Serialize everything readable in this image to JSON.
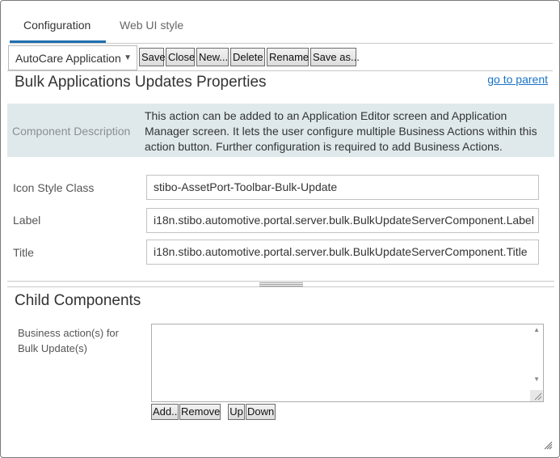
{
  "tabs": [
    {
      "label": "Configuration",
      "active": true
    },
    {
      "label": "Web UI style",
      "active": false
    }
  ],
  "toolbar": {
    "selector_value": "AutoCare Application",
    "save": "Save",
    "close": "Close",
    "new": "New...",
    "delete": "Delete",
    "rename": "Rename",
    "save_as": "Save as..."
  },
  "properties": {
    "title": "Bulk Applications Updates Properties",
    "go_to_parent": "go to parent",
    "description_label": "Component Description",
    "description_text": "This action can be added to an Application Editor screen and Application Manager screen. It lets the user configure multiple Business Actions within this action button. Further configuration is required to add Business Actions.",
    "fields": [
      {
        "label": "Icon Style Class",
        "value": "stibo-AssetPort-Toolbar-Bulk-Update"
      },
      {
        "label": "Label",
        "value": "i18n.stibo.automotive.portal.server.bulk.BulkUpdateServerComponent.Label"
      },
      {
        "label": "Title",
        "value": "i18n.stibo.automotive.portal.server.bulk.BulkUpdateServerComponent.Title"
      }
    ]
  },
  "child_components": {
    "title": "Child Components",
    "business_actions_label": "Business action(s) for Bulk Update(s)",
    "add": "Add..",
    "remove": "Remove",
    "up": "Up",
    "down": "Down"
  },
  "colors": {
    "accent": "#1f6fb0",
    "link": "#1a73c8",
    "description_bg": "#dfe9ec"
  }
}
